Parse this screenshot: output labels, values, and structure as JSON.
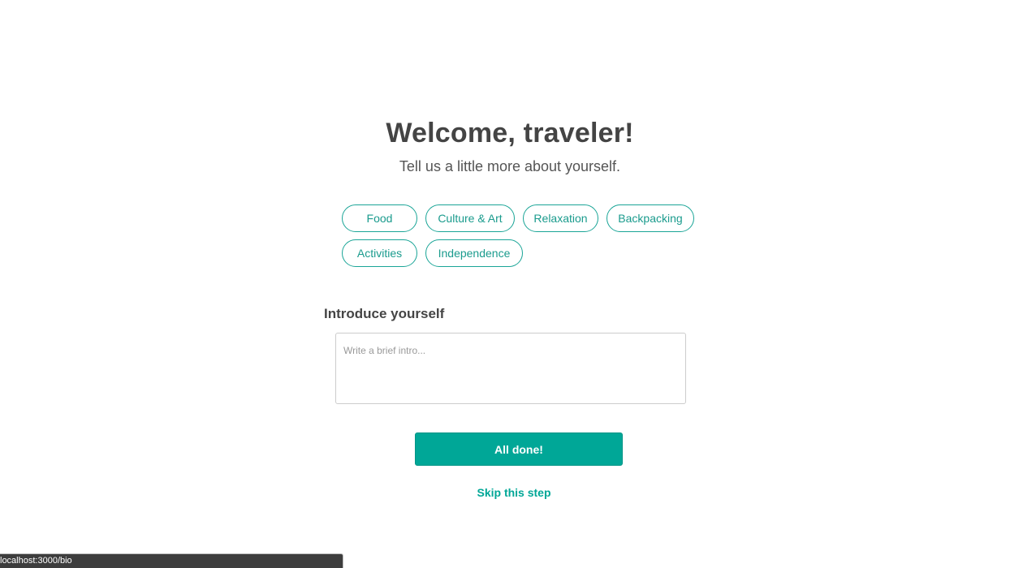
{
  "header": {
    "title": "Welcome, traveler!",
    "subtitle": "Tell us a little more about yourself."
  },
  "interests": {
    "row1": [
      "Food",
      "Culture & Art",
      "Relaxation",
      "Backpacking"
    ],
    "row2": [
      "Activities",
      "Independence"
    ]
  },
  "intro": {
    "label": "Introduce yourself",
    "placeholder": "Write a brief intro...",
    "value": ""
  },
  "actions": {
    "done_label": "All done!",
    "skip_label": "Skip this step"
  },
  "status_bar": {
    "url": "localhost:3000/bio"
  },
  "colors": {
    "accent": "#00a797",
    "text": "#444444"
  }
}
